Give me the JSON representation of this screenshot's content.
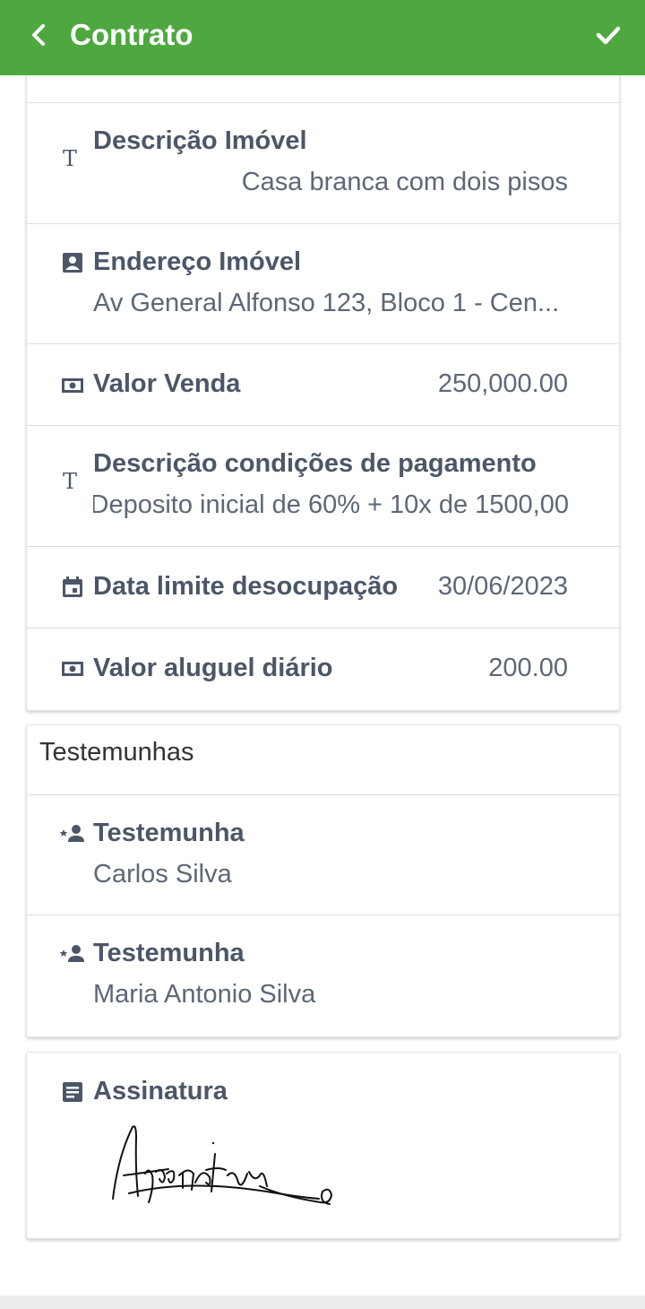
{
  "header": {
    "title": "Contrato",
    "back_icon": "chevron-left-icon",
    "confirm_icon": "check-icon",
    "color": "#4ea83f"
  },
  "fields": {
    "descricao_imovel": {
      "label": "Descrição Imóvel",
      "value": "Casa branca com dois pisos",
      "icon": "text-type-icon"
    },
    "endereco_imovel": {
      "label": "Endereço Imóvel",
      "value": "Av General Alfonso 123, Bloco 1 - Cen...",
      "icon": "contact-card-icon"
    },
    "valor_venda": {
      "label": "Valor Venda",
      "value": "250,000.00",
      "icon": "money-icon"
    },
    "descricao_pagamento": {
      "label": "Descrição condições de pagamento",
      "value": "Deposito inicial de 60% + 10x de 1500,00",
      "icon": "text-type-icon"
    },
    "data_limite": {
      "label": "Data limite desocupação",
      "value": "30/06/2023",
      "icon": "calendar-icon"
    },
    "valor_aluguel": {
      "label": "Valor aluguel diário",
      "value": "200.00",
      "icon": "money-icon"
    }
  },
  "witnesses": {
    "section_title": "Testemunhas",
    "items": [
      {
        "label": "Testemunha",
        "value": "Carlos Silva",
        "icon": "person-star-icon"
      },
      {
        "label": "Testemunha",
        "value": "Maria Antonio Silva",
        "icon": "person-star-icon"
      }
    ]
  },
  "signature": {
    "label": "Assinatura",
    "icon": "document-icon",
    "signature_text": "Assinatura"
  }
}
